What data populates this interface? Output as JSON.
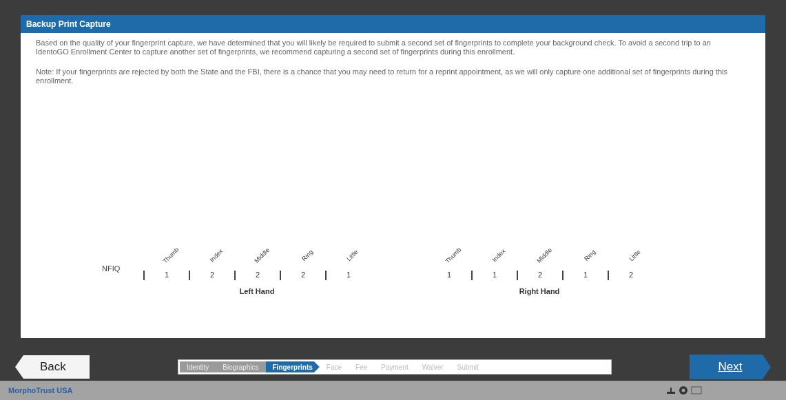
{
  "panel": {
    "title": "Backup Print Capture"
  },
  "paragraphs": [
    "Based on the quality of your fingerprint capture, we have determined that you will likely be required to submit a second set of fingerprints to complete your background check.  To avoid a second trip to an IdentoGO Enrollment Center to capture another set of fingerprints, we recommend capturing a second set of fingerprints during this enrollment.",
    "Note:  If your fingerprints are rejected by both the State and the FBI, there is a chance that you may need to return for a reprint appointment, as we will only capture one additional set of fingerprints during this enrollment."
  ],
  "row_label": "NFIQ",
  "hands": [
    {
      "label": "Left Hand",
      "fingers": [
        {
          "name": "Thumb",
          "score": "1"
        },
        {
          "name": "Index",
          "score": "2"
        },
        {
          "name": "Middle",
          "score": "2"
        },
        {
          "name": "Ring",
          "score": "2"
        },
        {
          "name": "Little",
          "score": "1"
        }
      ]
    },
    {
      "label": "Right Hand",
      "fingers": [
        {
          "name": "Thumb",
          "score": "1"
        },
        {
          "name": "Index",
          "score": "1"
        },
        {
          "name": "Middle",
          "score": "2"
        },
        {
          "name": "Ring",
          "score": "1"
        },
        {
          "name": "Little",
          "score": "2"
        }
      ]
    }
  ],
  "back_button": "Back",
  "next_button": "Next",
  "steps": [
    {
      "label": "Identity",
      "completed": true,
      "selected": false
    },
    {
      "label": "Biographics",
      "completed": true,
      "selected": false
    },
    {
      "label": "Fingerprints",
      "completed": false,
      "selected": true
    },
    {
      "label": "Face",
      "completed": false,
      "selected": false
    },
    {
      "label": "Fee",
      "completed": false,
      "selected": false
    },
    {
      "label": "Payment",
      "completed": false,
      "selected": false
    },
    {
      "label": "Waiver",
      "completed": false,
      "selected": false
    },
    {
      "label": "Submit",
      "completed": false,
      "selected": false
    }
  ],
  "status_bar": {
    "brand": "MorphoTrust USA"
  }
}
